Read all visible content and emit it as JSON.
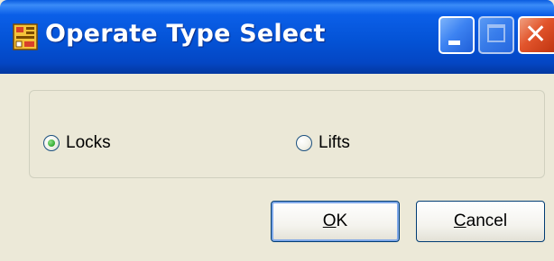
{
  "window": {
    "title": "Operate Type Select",
    "icon": "application-icon",
    "controls": {
      "minimize": "minimize-icon",
      "maximize": "maximize-icon",
      "close": "close-icon"
    }
  },
  "options": {
    "group": [
      {
        "label": "Locks",
        "selected": true
      },
      {
        "label": "Lifts",
        "selected": false
      }
    ]
  },
  "buttons": {
    "ok": {
      "mnemonic": "O",
      "rest": "K",
      "default": true
    },
    "cancel": {
      "mnemonic": "C",
      "rest": "ancel",
      "default": false
    }
  },
  "colors": {
    "titlebar": "#0453d6",
    "dialog_bg": "#ece9d8",
    "close_button": "#e2552c",
    "radio_dot": "#3eb33a"
  }
}
